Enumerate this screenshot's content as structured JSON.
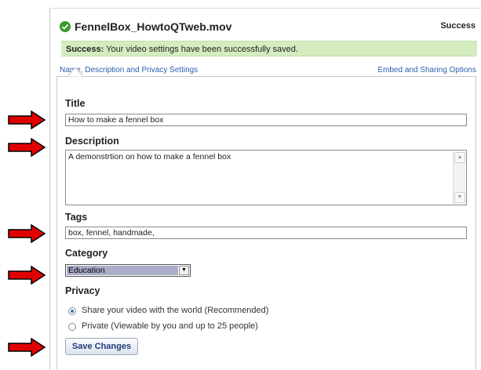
{
  "header": {
    "filename": "FennelBox_HowtoQTweb.mov",
    "status": "Success"
  },
  "banner": {
    "strong": "Success:",
    "message": " Your video settings have been successfully saved."
  },
  "tabs": {
    "left": "Name, Description and Privacy Settings",
    "right": "Embed and Sharing Options"
  },
  "form": {
    "title_label": "Title",
    "title_value": "How to make a fennel box",
    "description_label": "Description",
    "description_value": "A demonstrtion on how to make a fennel box",
    "tags_label": "Tags",
    "tags_value": "box, fennel, handmade,",
    "category_label": "Category",
    "category_value": "Education",
    "privacy_label": "Privacy",
    "privacy_options": [
      {
        "label": "Share your video with the world (Recommended)",
        "selected": true
      },
      {
        "label": "Private (Viewable by you and up to 25 people)",
        "selected": false
      }
    ],
    "save_label": "Save Changes"
  },
  "colors": {
    "banner": "#d5ecc0",
    "check": "#3a9a2c",
    "link": "#2a5db0",
    "arrow": "#e00000"
  }
}
